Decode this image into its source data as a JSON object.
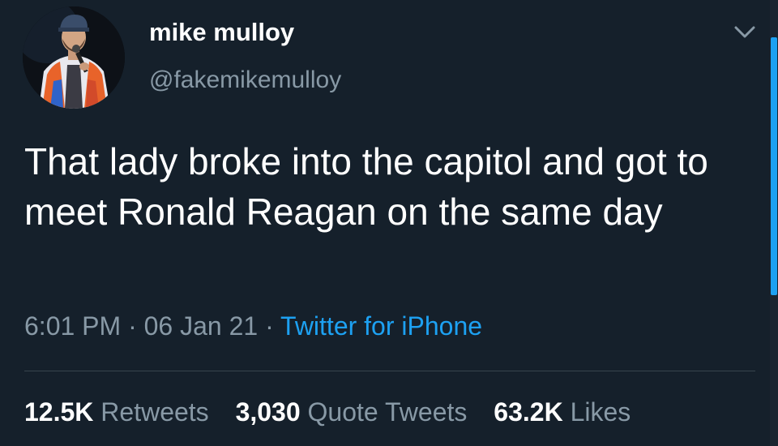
{
  "user": {
    "display_name": "mike mulloy",
    "handle": "@fakemikemulloy"
  },
  "tweet": {
    "text": "That lady broke into the capitol and got to meet Ronald Reagan on the same day",
    "time": "6:01 PM",
    "date": "06 Jan 21",
    "separator": "·",
    "source": "Twitter for iPhone"
  },
  "stats": {
    "retweets_count": "12.5K",
    "retweets_label": "Retweets",
    "quotes_count": "3,030",
    "quotes_label": "Quote Tweets",
    "likes_count": "63.2K",
    "likes_label": "Likes"
  },
  "icons": {
    "more": "chevron-down-icon"
  },
  "colors": {
    "background": "#15202b",
    "text": "#ffffff",
    "secondary_text": "#8899a6",
    "link": "#1da1f2",
    "divider": "#38444d"
  }
}
